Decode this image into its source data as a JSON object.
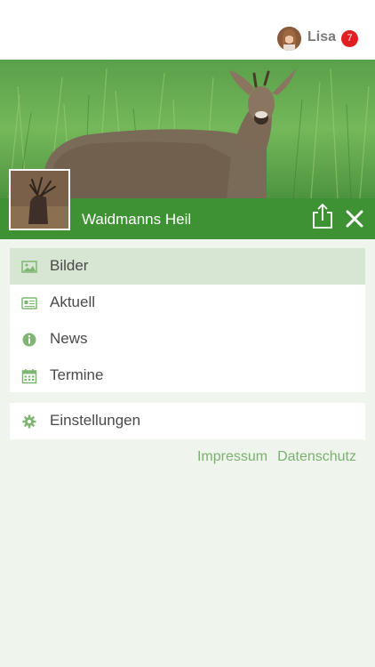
{
  "header": {
    "user_name": "Lisa",
    "notification_count": "7"
  },
  "club": {
    "name": "Waidmanns Heil"
  },
  "menu": {
    "items": [
      {
        "label": "Bilder",
        "icon": "image-icon",
        "active": true
      },
      {
        "label": "Aktuell",
        "icon": "newspaper-icon",
        "active": false
      },
      {
        "label": "News",
        "icon": "info-icon",
        "active": false
      },
      {
        "label": "Termine",
        "icon": "calendar-icon",
        "active": false
      }
    ],
    "settings": {
      "label": "Einstellungen",
      "icon": "gear-icon"
    }
  },
  "footer": {
    "impressum": "Impressum",
    "datenschutz": "Datenschutz"
  },
  "colors": {
    "brand_green": "#3e9234",
    "active_bg": "#d7e6d2",
    "link_green": "#7db072",
    "badge_red": "#e02020",
    "page_bg": "#eff5ec"
  }
}
